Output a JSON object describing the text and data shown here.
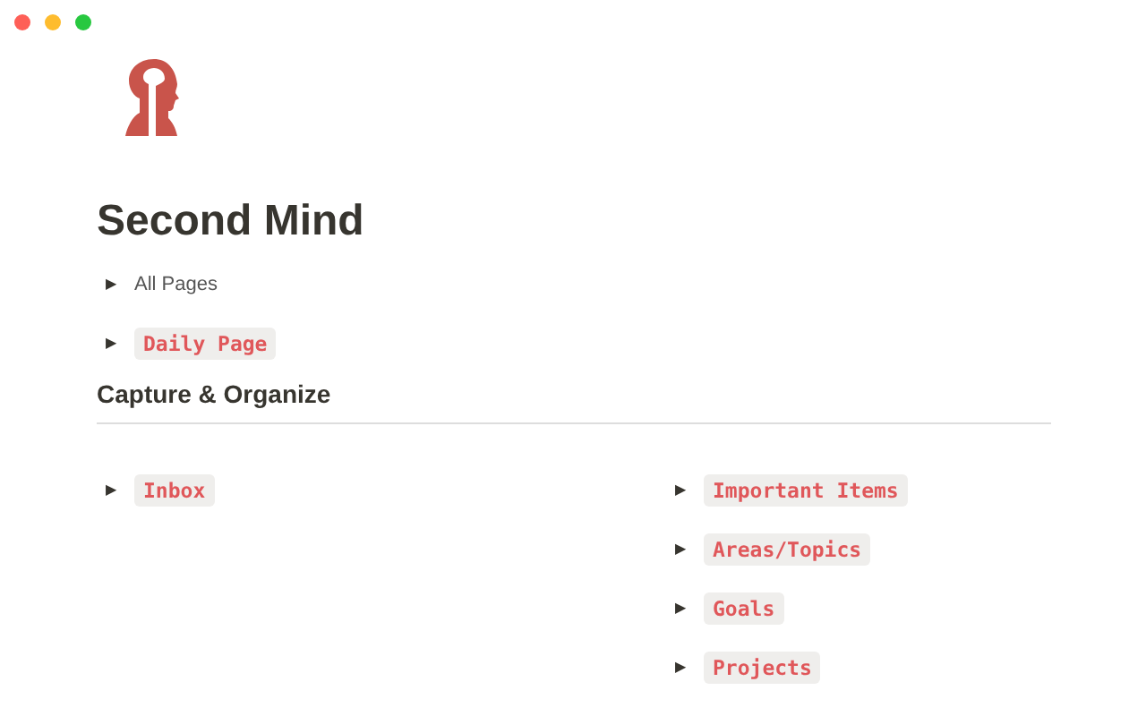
{
  "window": {
    "controls": [
      {
        "color": "#fe5f57"
      },
      {
        "color": "#febc2e"
      },
      {
        "color": "#28c840"
      }
    ]
  },
  "page": {
    "title": "Second Mind",
    "items": [
      {
        "kind": "plain",
        "toggle": "▶",
        "label": "All Pages"
      },
      {
        "kind": "code",
        "toggle": "▶",
        "label": "Daily Page"
      }
    ],
    "section": {
      "heading": "Capture & Organize",
      "columns": [
        [
          {
            "kind": "code",
            "toggle": "▶",
            "label": "Inbox"
          }
        ],
        [
          {
            "kind": "code",
            "toggle": "▶",
            "label": "Important Items"
          },
          {
            "kind": "code",
            "toggle": "▶",
            "label": "Areas/Topics"
          },
          {
            "kind": "code",
            "toggle": "▶",
            "label": "Goals"
          },
          {
            "kind": "code",
            "toggle": "▶",
            "label": "Projects"
          }
        ]
      ]
    }
  }
}
